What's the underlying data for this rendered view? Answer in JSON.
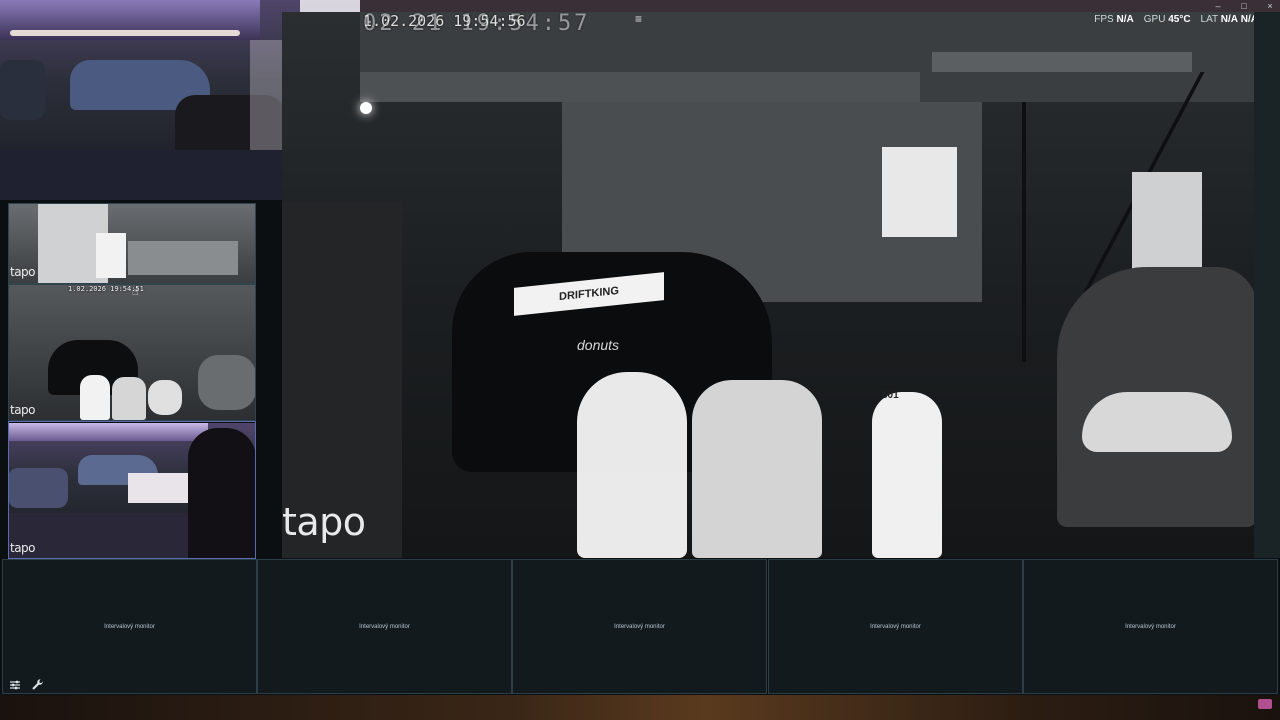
{
  "window": {
    "minimize_label": "–",
    "maximize_label": "□",
    "close_label": "×"
  },
  "main_feed": {
    "timestamp_small": "1.02.2026 19:54:56",
    "timestamp_big": "02 21 19:54:57",
    "watermark": "tapo",
    "car_windshield_text": "DRIFTKING",
    "car_door_text": "donuts",
    "bike_number": "601"
  },
  "hud": {
    "fps_label": "FPS",
    "fps_value": "N/A",
    "gpu_label": "GPU",
    "gpu_value": "45°C",
    "lat_label": "LAT",
    "lat_value": "N/A",
    "extra_value": "N/A"
  },
  "thumbnails": [
    {
      "watermark": "tapo"
    },
    {
      "watermark": "tapo",
      "timestamp": "1.02.2026 19:54:51"
    },
    {
      "watermark": "tapo"
    }
  ],
  "monitors": [
    {
      "label": "Intervalový monitor"
    },
    {
      "label": "Intervalový monitor"
    },
    {
      "label": "Intervalový monitor"
    },
    {
      "label": "Intervalový monitor"
    },
    {
      "label": "Intervalový monitor"
    }
  ],
  "toolbar": {
    "settings_icon": "sliders-icon",
    "tools_icon": "wrench-icon"
  },
  "colors": {
    "accent_selected": "#5a6bb0",
    "tile_border": "#2c3e47",
    "background": "#0b0f12"
  }
}
